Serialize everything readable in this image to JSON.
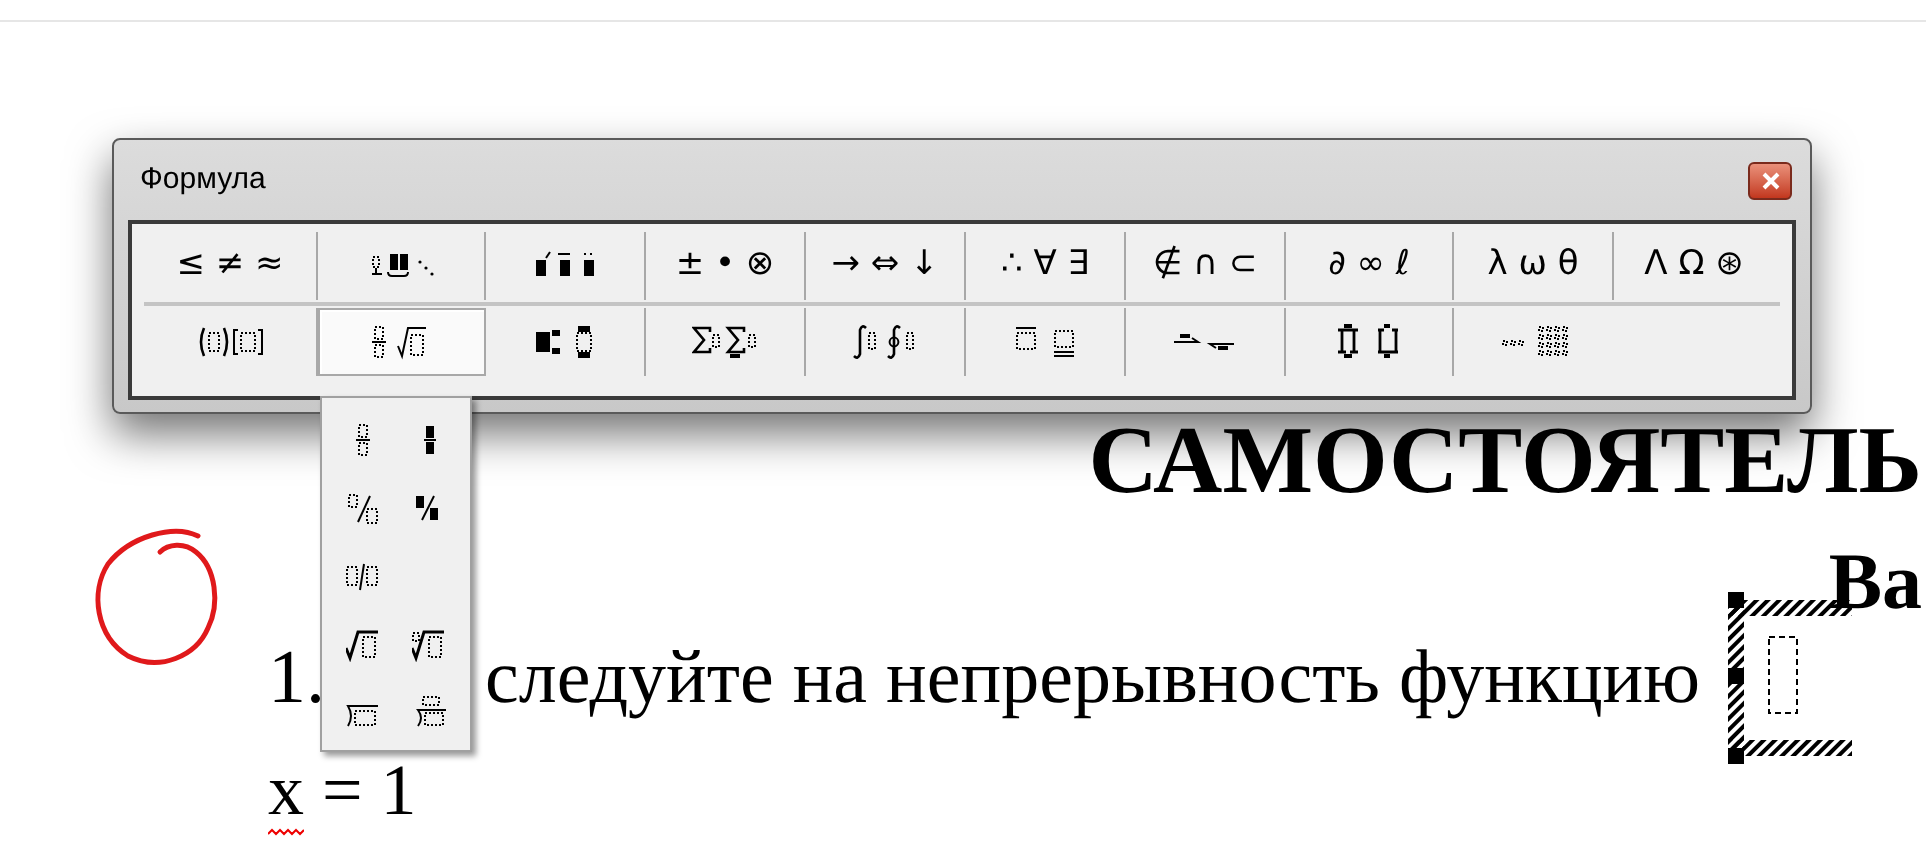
{
  "window": {
    "title": "Формула"
  },
  "palette": {
    "rows": [
      [
        {
          "kind": "symbols",
          "text": "≤ ≠ ≈",
          "selected": false
        },
        {
          "kind": "spaces",
          "selected": false
        },
        {
          "kind": "embellishments",
          "selected": false
        },
        {
          "kind": "symbols",
          "text": "± • ⊗",
          "selected": false
        },
        {
          "kind": "symbols",
          "text": "→ ⇔ ↓",
          "selected": false
        },
        {
          "kind": "symbols",
          "text": "∴ ∀ ∃",
          "selected": false
        },
        {
          "kind": "symbols",
          "text": "∉ ∩ ⊂",
          "selected": false
        },
        {
          "kind": "symbols",
          "text": "∂ ∞ ℓ",
          "selected": false
        },
        {
          "kind": "symbols",
          "text": "λ ω θ",
          "selected": false
        },
        {
          "kind": "symbols",
          "text": "Λ Ω ⊛",
          "selected": false
        }
      ],
      [
        {
          "kind": "fences",
          "selected": false
        },
        {
          "kind": "fractions",
          "selected": true
        },
        {
          "kind": "scripts",
          "selected": false
        },
        {
          "kind": "sums",
          "selected": false
        },
        {
          "kind": "integrals",
          "selected": false
        },
        {
          "kind": "bars",
          "selected": false
        },
        {
          "kind": "arrows",
          "selected": false
        },
        {
          "kind": "products",
          "selected": false
        },
        {
          "kind": "matrices",
          "selected": false
        }
      ]
    ]
  },
  "menu": {
    "items": [
      {
        "kind": "fraction"
      },
      {
        "kind": "small_fraction"
      },
      {
        "kind": "slash"
      },
      {
        "kind": "small_slash"
      },
      {
        "kind": "inline_slash"
      },
      {
        "kind": "blank"
      },
      {
        "kind": "sqrt"
      },
      {
        "kind": "nth_root"
      },
      {
        "kind": "division"
      },
      {
        "kind": "division_quotient"
      }
    ]
  },
  "document": {
    "heading": "САМОСТОЯТЕЛЬ",
    "subheading": "Ва",
    "task": {
      "number": "1.",
      "text": "следуйте на непрерывность функцию"
    },
    "condition": "x = 1"
  }
}
